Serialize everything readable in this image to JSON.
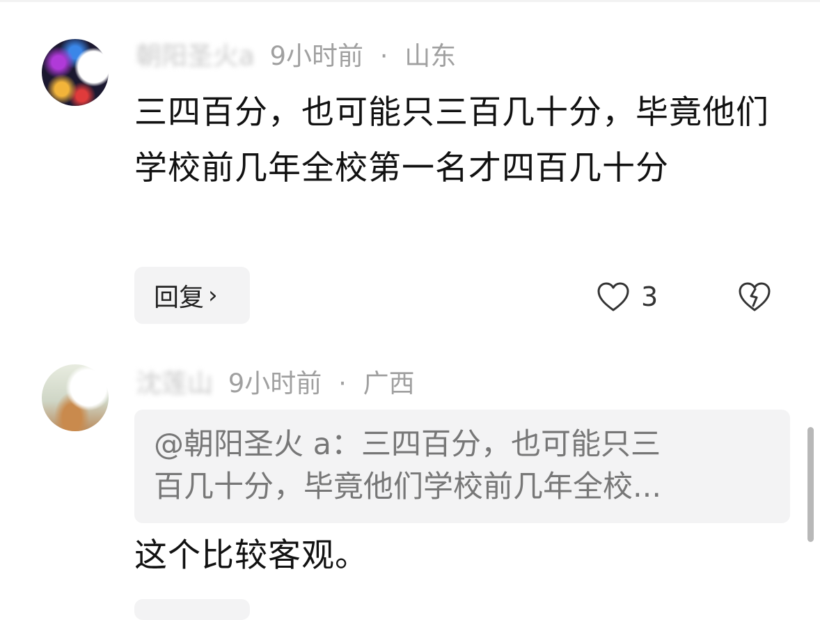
{
  "comments": [
    {
      "author": "朝阳圣火a",
      "time": "9小时前",
      "separator": "·",
      "location": "山东",
      "text": "三四百分，也可能只三百几十分，毕竟他们学校前几年全校第一名才四百几十分",
      "reply_label": "回复",
      "reply_chevron": "›",
      "like_count": "3",
      "like_icon": "heart-outline-icon",
      "dislike_icon": "broken-heart-icon"
    },
    {
      "author": "",
      "author_blurred": "沈莲山",
      "time": "9小时前",
      "separator": "·",
      "location": "广西",
      "quote_line1": "@朝阳圣火 a：三四百分，也可能只三",
      "quote_line2": "百几十分，毕竟他们学校前几年全校...",
      "text": "这个比较客观。"
    }
  ],
  "colors": {
    "meta_text": "#a0a0a0",
    "body_text": "#111111",
    "quote_bg": "#f3f3f4",
    "quote_text": "#777777",
    "reply_bg": "#f3f3f4"
  }
}
